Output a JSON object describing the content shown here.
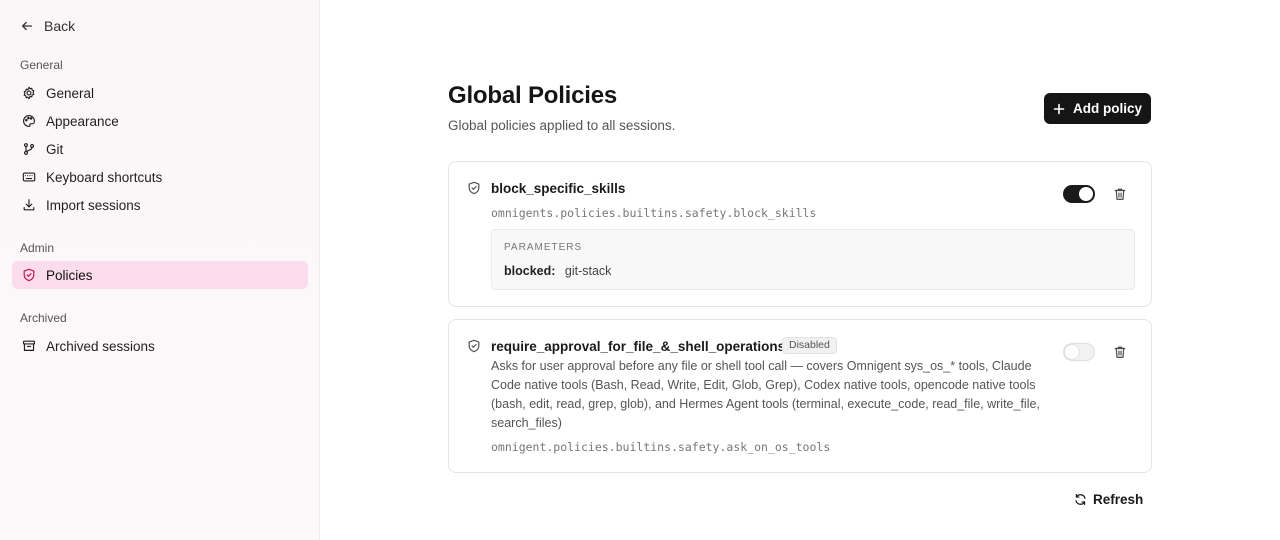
{
  "sidebar": {
    "back_label": "Back",
    "sections": {
      "general": "General",
      "admin": "Admin",
      "archived": "Archived"
    },
    "items": [
      {
        "label": "General",
        "icon": "gear-icon"
      },
      {
        "label": "Appearance",
        "icon": "palette-icon"
      },
      {
        "label": "Git",
        "icon": "git-branch-icon"
      },
      {
        "label": "Keyboard shortcuts",
        "icon": "keyboard-icon"
      },
      {
        "label": "Import sessions",
        "icon": "download-icon"
      },
      {
        "label": "Policies",
        "icon": "shield-icon",
        "active": true
      },
      {
        "label": "Archived sessions",
        "icon": "archive-icon"
      }
    ]
  },
  "main": {
    "title": "Global Policies",
    "subtitle": "Global policies applied to all sessions.",
    "add_policy_label": "Add policy",
    "refresh_label": "Refresh",
    "policies": [
      {
        "name": "block_specific_skills",
        "path": "omnigents.policies.builtins.safety.block_skills",
        "enabled": true,
        "parameters_title": "PARAMETERS",
        "parameters": [
          {
            "key": "blocked:",
            "value": "git-stack"
          }
        ]
      },
      {
        "name": "require_approval_for_file_&_shell_operations",
        "badge": "Disabled",
        "description": "Asks for user approval before any file or shell tool call — covers Omnigent sys_os_* tools, Claude Code native tools (Bash, Read, Write, Edit, Glob, Grep), Codex native tools, opencode native tools (bash, edit, read, grep, glob), and Hermes Agent tools (terminal, execute_code, read_file, write_file, search_files)",
        "path": "omnigent.policies.builtins.safety.ask_on_os_tools",
        "enabled": false
      }
    ]
  },
  "colors": {
    "active_nav_bg": "#fadcec",
    "primary_button": "#151515",
    "toggle_on": "#1a1a1a"
  }
}
